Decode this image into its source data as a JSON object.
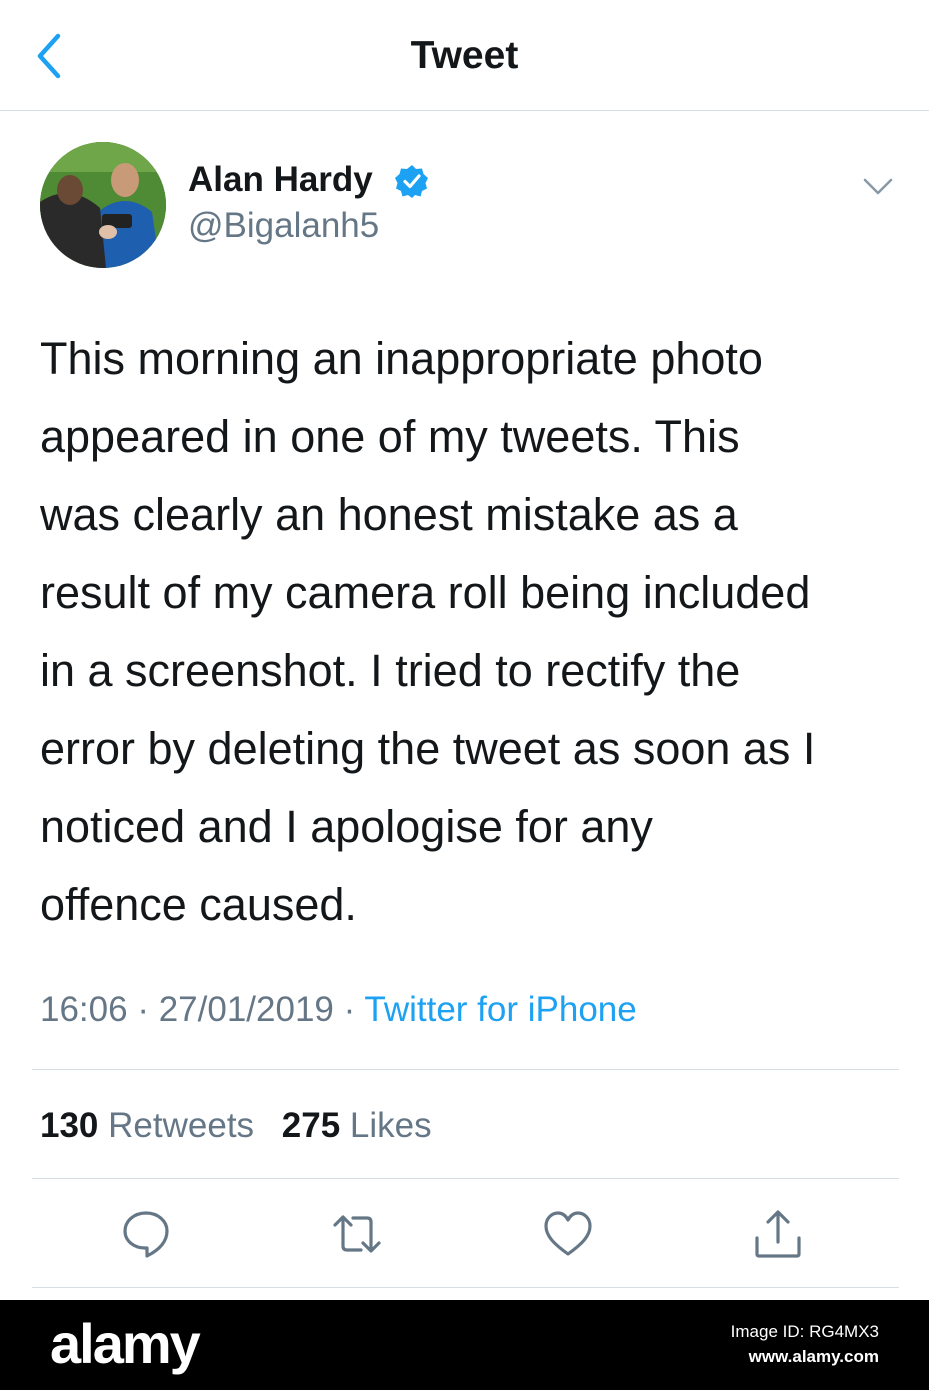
{
  "header": {
    "title": "Tweet",
    "back_icon": "chevron-left-icon",
    "accent_color": "#1da1f2"
  },
  "author": {
    "display_name": "Alan Hardy",
    "handle": "@Bigalanh5",
    "verified": true,
    "avatar": "profile-photo"
  },
  "tweet": {
    "text": "This morning an inappropriate photo\nappeared in one of my tweets. This\nwas clearly an honest mistake as a\nresult of my camera roll being included\nin a screenshot. I tried to rectify the\nerror by deleting the tweet as soon as I\nnoticed and I apologise for any\noffence caused.",
    "time": "16:06",
    "date": "27/01/2019",
    "separator": "·",
    "source": "Twitter for iPhone"
  },
  "stats": {
    "retweets_count": "130",
    "retweets_label": "Retweets",
    "likes_count": "275",
    "likes_label": "Likes"
  },
  "actions": [
    "reply-icon",
    "retweet-icon",
    "like-icon",
    "share-icon"
  ],
  "watermark": {
    "logo": "alamy",
    "image_id": "Image ID: RG4MX3",
    "url": "www.alamy.com"
  }
}
